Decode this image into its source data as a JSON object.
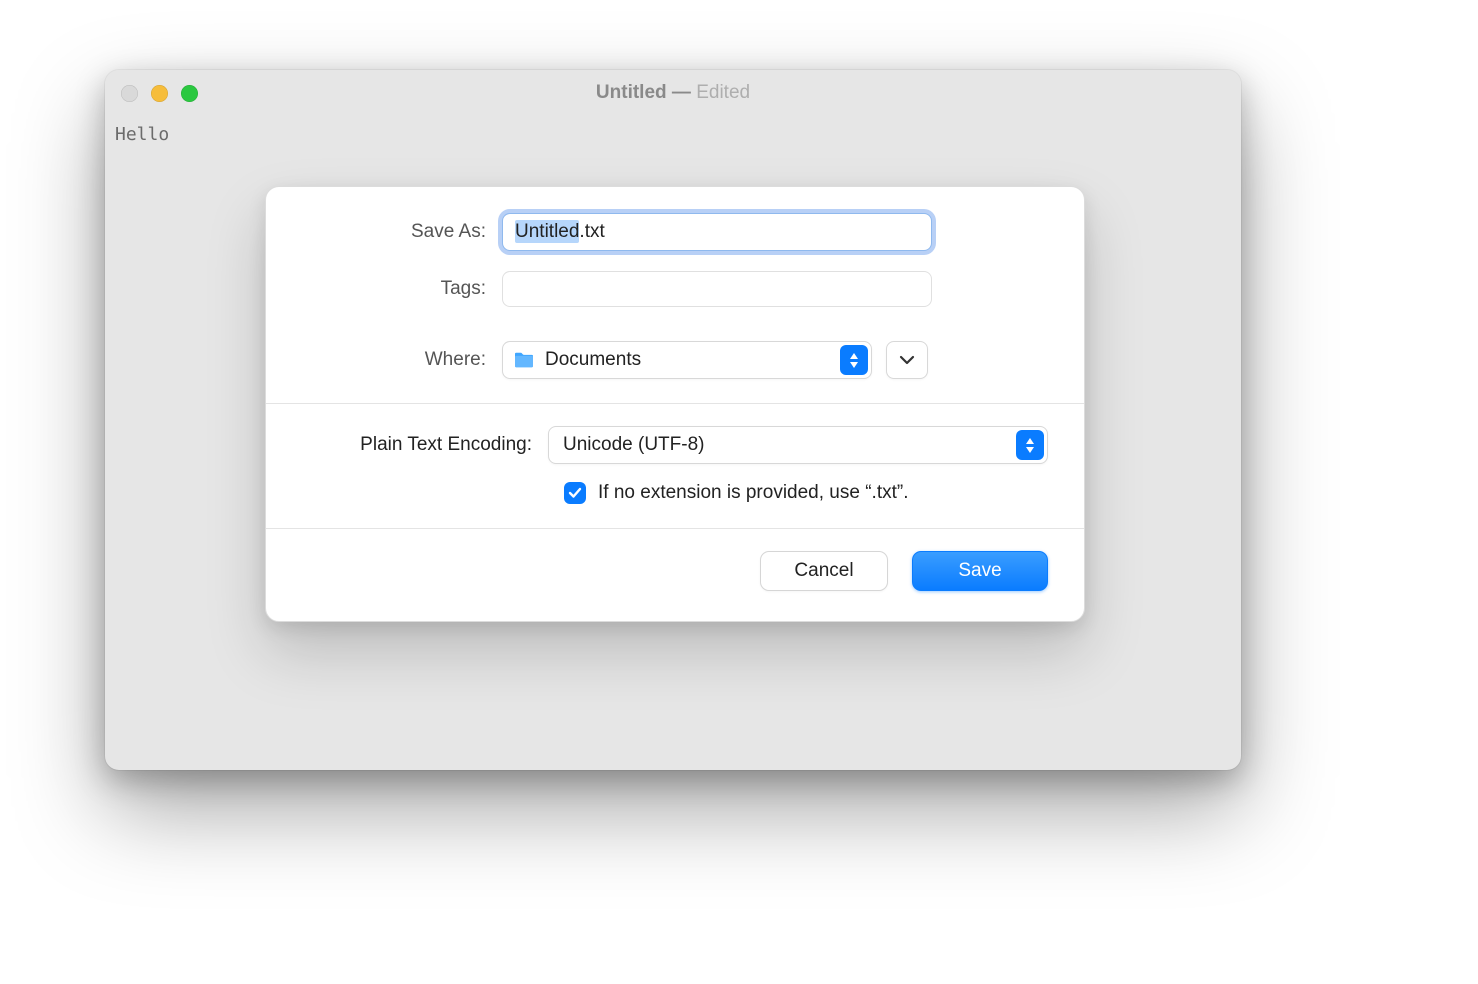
{
  "window": {
    "title": "Untitled",
    "separator": " — ",
    "status": "Edited",
    "document_text": "Hello"
  },
  "dialog": {
    "save_as_label": "Save As:",
    "filename_base": "Untitled",
    "filename_ext": ".txt",
    "tags_label": "Tags:",
    "tags_value": "",
    "where_label": "Where:",
    "where_value": "Documents",
    "encoding_label": "Plain Text Encoding:",
    "encoding_value": "Unicode (UTF-8)",
    "extension_checkbox_checked": true,
    "extension_checkbox_label": "If no extension is provided, use “.txt”.",
    "cancel_label": "Cancel",
    "save_label": "Save"
  },
  "colors": {
    "accent": "#0a7cff"
  }
}
